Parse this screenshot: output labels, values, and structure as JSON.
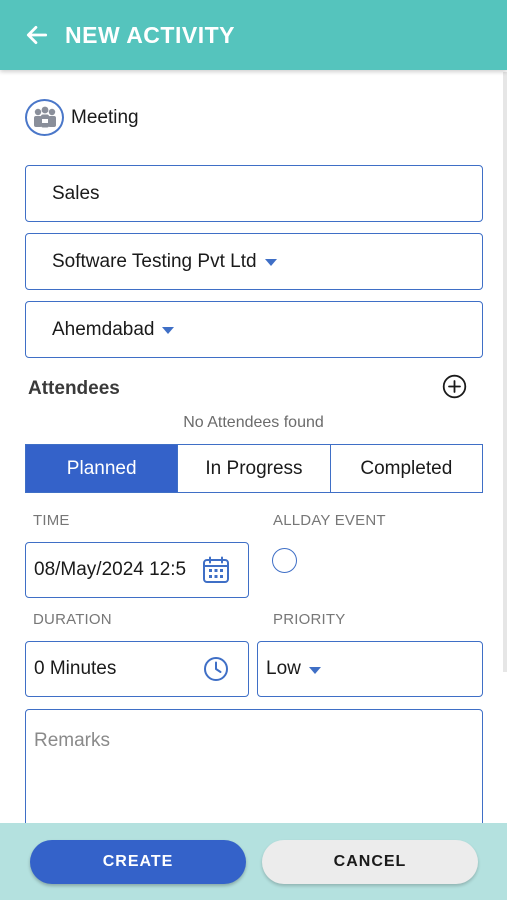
{
  "header": {
    "title": "NEW ACTIVITY",
    "back_icon": "arrow-left-icon"
  },
  "activity_type": {
    "label": "Meeting",
    "icon": "meeting-people-icon"
  },
  "fields": {
    "subject": "Sales",
    "company": "Software Testing Pvt Ltd",
    "location": "Ahemdabad"
  },
  "attendees": {
    "title": "Attendees",
    "empty_text": "No Attendees found",
    "add_icon": "plus-circle-icon"
  },
  "status": {
    "options": [
      "Planned",
      "In Progress",
      "Completed"
    ],
    "selected": "Planned"
  },
  "time": {
    "label": "TIME",
    "value": "08/May/2024 12:5",
    "icon": "calendar-icon"
  },
  "allday": {
    "label": "ALLDAY EVENT",
    "checked": false
  },
  "duration": {
    "label": "DURATION",
    "value": "0 Minutes",
    "icon": "clock-icon"
  },
  "priority": {
    "label": "PRIORITY",
    "value": "Low"
  },
  "remarks": {
    "placeholder": "Remarks",
    "value": ""
  },
  "actions": {
    "create_label": "CREATE",
    "cancel_label": "CANCEL"
  },
  "colors": {
    "header": "#55c4bd",
    "accent": "#3462c9",
    "footer": "#b4e1df"
  }
}
